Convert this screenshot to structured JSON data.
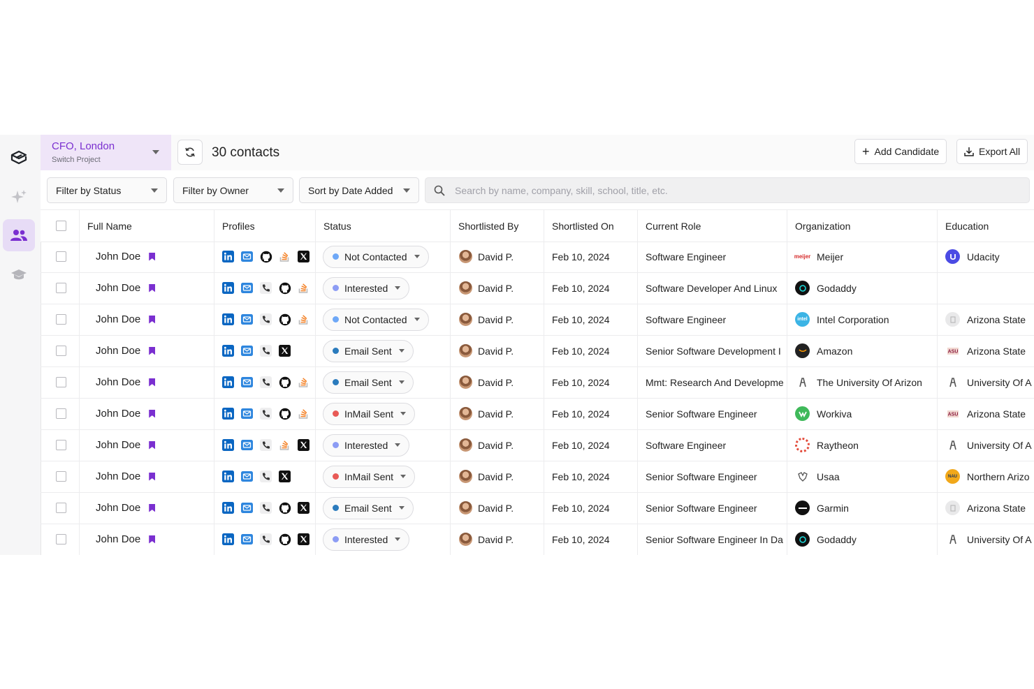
{
  "project": {
    "name": "CFO, London",
    "sub": "Switch Project"
  },
  "toolbar": {
    "contacts": "30 contacts",
    "add_candidate": "Add Candidate",
    "export_all": "Export All"
  },
  "filters": {
    "status": "Filter by Status",
    "owner": "Filter by Owner",
    "sort": "Sort by Date Added",
    "search_placeholder": "Search by name, company, skill, school, title, etc."
  },
  "colors": {
    "accent": "#7a2fd0",
    "status_not_contacted": "#6ea8f7",
    "status_interested": "#8c9cf4",
    "status_email_sent": "#2b7bbd",
    "status_inmail_sent": "#e85a56"
  },
  "table": {
    "headers": [
      "Full Name",
      "Profiles",
      "Status",
      "Shortlisted By",
      "Shortlisted On",
      "Current Role",
      "Organization",
      "Education"
    ],
    "rows": [
      {
        "name": "John Doe",
        "profiles": [
          "linkedin",
          "email",
          "github",
          "stackoverflow",
          "x"
        ],
        "status": "Not Contacted",
        "status_key": "not_contacted",
        "by": "David P.",
        "on": "Feb 10, 2024",
        "role": "Software Engineer",
        "org": "Meijer",
        "org_logo": "meijer-logo",
        "edu": "Udacity",
        "edu_logo": "udacity-logo"
      },
      {
        "name": "John Doe",
        "profiles": [
          "linkedin",
          "email",
          "phone",
          "github",
          "stackoverflow"
        ],
        "status": "Interested",
        "status_key": "interested",
        "by": "David P.",
        "on": "Feb 10, 2024",
        "role": "Software Developer And Linux",
        "org": "Godaddy",
        "org_logo": "godaddy-logo",
        "edu": "",
        "edu_logo": ""
      },
      {
        "name": "John Doe",
        "profiles": [
          "linkedin",
          "email",
          "phone",
          "github",
          "stackoverflow"
        ],
        "status": "Not Contacted",
        "status_key": "not_contacted",
        "by": "David P.",
        "on": "Feb 10, 2024",
        "role": "Software Engineer",
        "org": "Intel Corporation",
        "org_logo": "intel-logo",
        "edu": "Arizona State",
        "edu_logo": "arizona-state-logo-gray"
      },
      {
        "name": "John Doe",
        "profiles": [
          "linkedin",
          "email",
          "phone",
          "x"
        ],
        "status": "Email Sent",
        "status_key": "email_sent",
        "by": "David P.",
        "on": "Feb 10, 2024",
        "role": "Senior Software Development I",
        "org": "Amazon",
        "org_logo": "amazon-logo",
        "edu": "Arizona State",
        "edu_logo": "asu-logo"
      },
      {
        "name": "John Doe",
        "profiles": [
          "linkedin",
          "email",
          "phone",
          "github",
          "stackoverflow"
        ],
        "status": "Email Sent",
        "status_key": "email_sent",
        "by": "David P.",
        "on": "Feb 10, 2024",
        "role": "Mmt: Research And Developme",
        "org": "The University Of Arizon",
        "org_logo": "university-arizona-logo",
        "edu": "University Of A",
        "edu_logo": "university-arizona-logo"
      },
      {
        "name": "John Doe",
        "profiles": [
          "linkedin",
          "email",
          "phone",
          "github",
          "stackoverflow"
        ],
        "status": "InMail Sent",
        "status_key": "inmail_sent",
        "by": "David P.",
        "on": "Feb 10, 2024",
        "role": "Senior Software Engineer",
        "org": "Workiva",
        "org_logo": "workiva-logo",
        "edu": "Arizona State",
        "edu_logo": "asu-logo"
      },
      {
        "name": "John Doe",
        "profiles": [
          "linkedin",
          "email",
          "phone",
          "stackoverflow",
          "x"
        ],
        "status": "Interested",
        "status_key": "interested",
        "by": "David P.",
        "on": "Feb 10, 2024",
        "role": "Software Engineer",
        "org": "Raytheon",
        "org_logo": "raytheon-logo",
        "edu": "University Of A",
        "edu_logo": "university-arizona-logo"
      },
      {
        "name": "John Doe",
        "profiles": [
          "linkedin",
          "email",
          "phone",
          "x"
        ],
        "status": "InMail Sent",
        "status_key": "inmail_sent",
        "by": "David P.",
        "on": "Feb 10, 2024",
        "role": "Senior Software Engineer",
        "org": "Usaa",
        "org_logo": "usaa-logo",
        "edu": "Northern Arizo",
        "edu_logo": "nau-logo"
      },
      {
        "name": "John Doe",
        "profiles": [
          "linkedin",
          "email",
          "phone",
          "github",
          "x"
        ],
        "status": "Email Sent",
        "status_key": "email_sent",
        "by": "David P.",
        "on": "Feb 10, 2024",
        "role": "Senior Software Engineer",
        "org": "Garmin",
        "org_logo": "garmin-logo",
        "edu": "Arizona State",
        "edu_logo": "arizona-state-logo-gray"
      },
      {
        "name": "John Doe",
        "profiles": [
          "linkedin",
          "email",
          "phone",
          "github",
          "x"
        ],
        "status": "Interested",
        "status_key": "interested",
        "by": "David P.",
        "on": "Feb 10, 2024",
        "role": "Senior Software Engineer In Da",
        "org": "Godaddy",
        "org_logo": "godaddy-logo",
        "edu": "University Of A",
        "edu_logo": "university-arizona-logo"
      }
    ]
  }
}
